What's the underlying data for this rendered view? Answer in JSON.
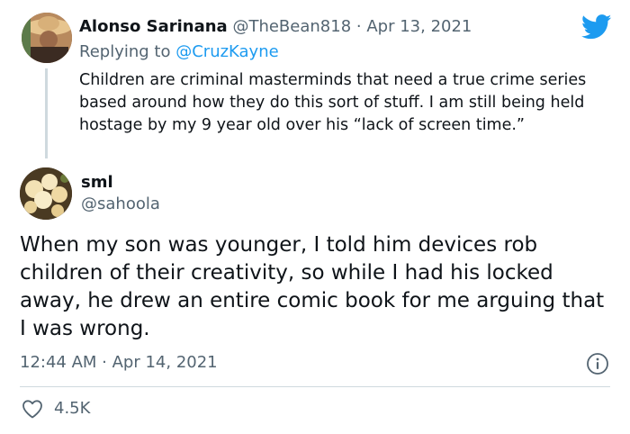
{
  "parent_tweet": {
    "name": "Alonso Sarinana",
    "handle": "@TheBean818",
    "separator": "·",
    "date": "Apr 13, 2021",
    "replying_prefix": "Replying to",
    "replying_handle": "@CruzKayne",
    "text": "Children are criminal masterminds that need a true crime series based around how they do this sort of stuff. I am still being held hostage by my 9 year old over his “lack of screen time.”"
  },
  "main_tweet": {
    "name": "sml",
    "handle": "@sahoola",
    "text": "When my son was younger, I told him devices rob children of their creativity, so while I had his locked away, he drew an entire comic book for me arguing that I was wrong.",
    "timestamp": "12:44 AM · Apr 14, 2021",
    "likes": "4.5K"
  },
  "icons": {
    "brand": "twitter-bird-icon",
    "info": "info-icon",
    "like": "heart-icon"
  },
  "colors": {
    "brand_blue": "#1d9bf0",
    "muted": "#536471",
    "text": "#0f1419",
    "divider": "#cfd9de"
  }
}
